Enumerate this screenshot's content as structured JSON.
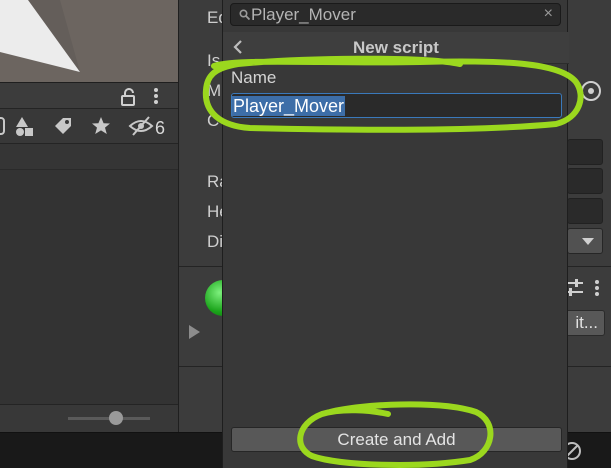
{
  "project_panel": {
    "hidden_count": "6"
  },
  "inspector": {
    "labels": [
      "Ed",
      "Is",
      "M",
      "C",
      "Ra",
      "He",
      "Di"
    ],
    "edit_button_label": "it..."
  },
  "popup": {
    "search": {
      "value": "Player_Mover",
      "clear": "×"
    },
    "title": "New script",
    "name_label": "Name",
    "name_value": "Player_Mover",
    "create_button_label": "Create and Add"
  },
  "colors": {
    "annotation": "#9bd81e",
    "selection": "#3d6ea8",
    "input_focus": "#3a79bb"
  },
  "icons": [
    "lock-icon",
    "menu-dots-icon",
    "prefab-icon",
    "shapes-icon",
    "tag-icon",
    "star-icon",
    "eye-slash-icon",
    "search-icon",
    "clear-icon",
    "back-icon",
    "target-icon",
    "dropdown-arrow-icon",
    "sliders-icon",
    "play-icon"
  ]
}
